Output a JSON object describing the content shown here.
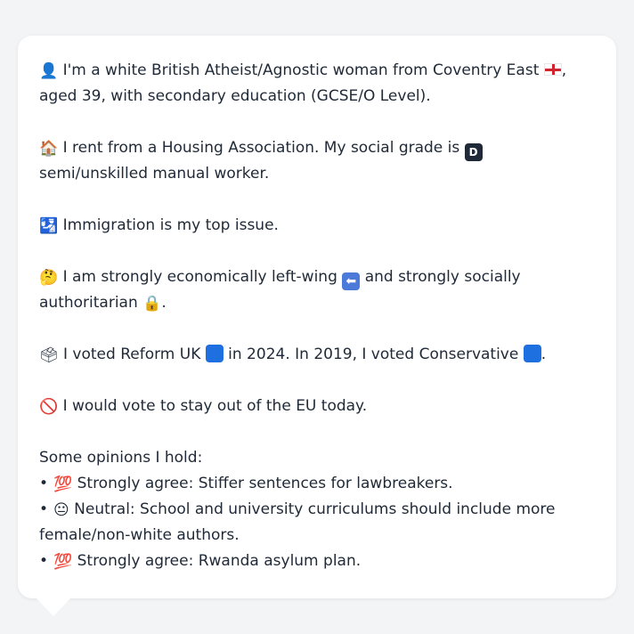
{
  "profile": {
    "p1": {
      "icon": "👤",
      "text_a": "I'm a white British Atheist/Agnostic woman from Coventry East",
      "text_b": ", aged 39, with secondary education (GCSE/O Level)."
    },
    "p2": {
      "icon": "🏠",
      "text_a": "I rent from a Housing Association. My social grade is",
      "grade_letter": "D",
      "text_b": "semi/unskilled manual worker."
    },
    "p3": {
      "icon": "🛂",
      "text": "Immigration is my top issue."
    },
    "p4": {
      "icon": "🤔",
      "text_a": "I am strongly economically left-wing",
      "arrow": "⬅",
      "text_b": "and strongly socially authoritarian",
      "lock": "🔒",
      "text_c": "."
    },
    "p5": {
      "icon": "🗳",
      "text_a": "I voted Reform UK",
      "text_b": "in 2024. In 2019, I voted Conservative",
      "text_c": "."
    },
    "p6": {
      "icon": "🚫",
      "text": "I would vote to stay out of the EU today."
    },
    "opinions": {
      "heading": "Some opinions I hold:",
      "items": [
        {
          "bullet": "•",
          "icon": "💯",
          "text": "Strongly agree: Stiffer sentences for lawbreakers."
        },
        {
          "bullet": "•",
          "icon": "😐",
          "text": "Neutral: School and university curriculums should include more female/non-white authors."
        },
        {
          "bullet": "•",
          "icon": "💯",
          "text": "Strongly agree: Rwanda asylum plan."
        }
      ]
    }
  },
  "colors": {
    "reform_uk": "#1e6fe0",
    "conservative": "#1e6fe0",
    "flag_red": "#d0242f"
  }
}
